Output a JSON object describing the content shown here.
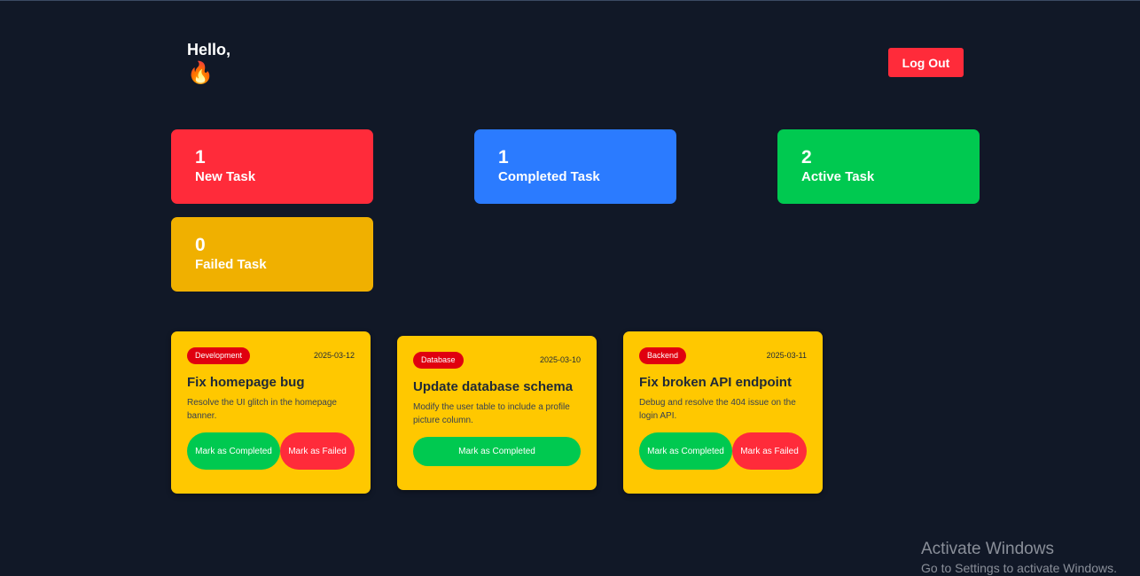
{
  "header": {
    "greeting": "Hello,",
    "emoji": "🔥",
    "logout_label": "Log Out"
  },
  "stats": [
    {
      "count": "1",
      "label": "New Task",
      "color": "#ff2b3a"
    },
    {
      "count": "1",
      "label": "Completed Task",
      "color": "#2b7bff"
    },
    {
      "count": "2",
      "label": "Active Task",
      "color": "#00c950"
    },
    {
      "count": "0",
      "label": "Failed Task",
      "color": "#f0b000"
    }
  ],
  "tasks": [
    {
      "category": "Development",
      "date": "2025-03-12",
      "title": "Fix homepage bug",
      "description": "Resolve the UI glitch in the homepage banner.",
      "complete_label": "Mark as Completed",
      "fail_label": "Mark as Failed"
    },
    {
      "category": "Database",
      "date": "2025-03-10",
      "title": "Update database schema",
      "description": "Modify the user table to include a profile picture column.",
      "complete_label": "Mark as Completed"
    },
    {
      "category": "Backend",
      "date": "2025-03-11",
      "title": "Fix broken API endpoint",
      "description": "Debug and resolve the 404 issue on the login API.",
      "complete_label": "Mark as Completed",
      "fail_label": "Mark as Failed"
    }
  ],
  "watermark": {
    "title": "Activate Windows",
    "subtitle": "Go to Settings to activate Windows."
  }
}
